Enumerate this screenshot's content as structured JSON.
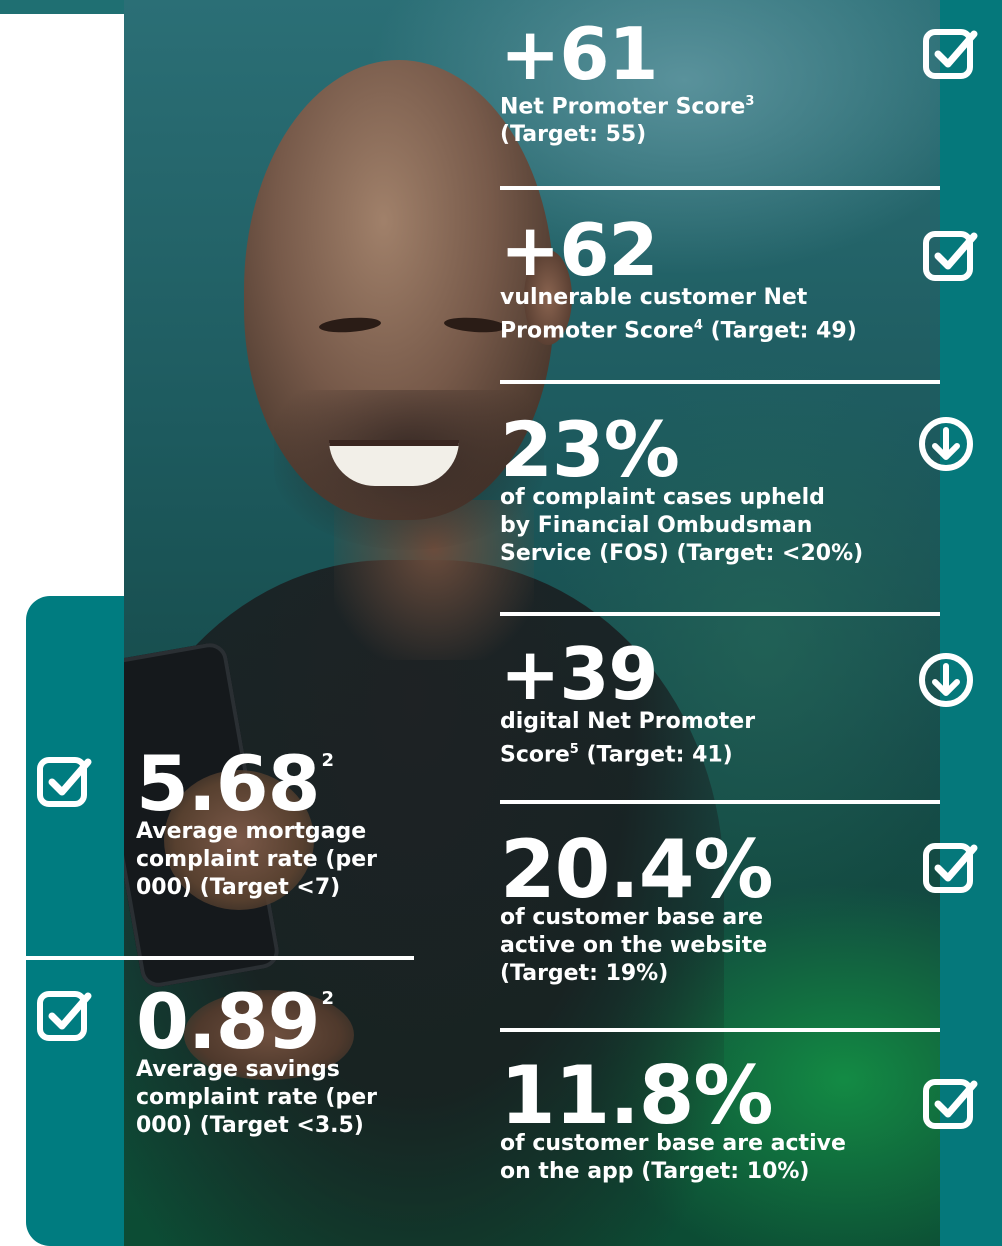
{
  "right_column": [
    {
      "value": "+61",
      "desc_lines": [
        "Net Promoter Score",
        "(Target: 55)"
      ],
      "sup": "3",
      "icon": "check-square-icon"
    },
    {
      "value": "+62",
      "desc_lines": [
        "vulnerable customer Net",
        "Promoter Score",
        "(Target: 49)"
      ],
      "sup": "4",
      "icon": "check-square-icon"
    },
    {
      "value": "23%",
      "desc_lines": [
        "of complaint cases upheld",
        "by Financial Ombudsman",
        "Service (FOS) (Target: <20%)"
      ],
      "icon": "arrow-down-circle-icon"
    },
    {
      "value": "+39",
      "desc_lines": [
        "digital Net Promoter",
        "Score",
        "(Target: 41)"
      ],
      "sup": "5",
      "icon": "arrow-down-circle-icon"
    },
    {
      "value": "20.4%",
      "desc_lines": [
        "of customer base are",
        "active on the website",
        "(Target: 19%)"
      ],
      "icon": "check-square-icon"
    },
    {
      "value": "11.8%",
      "desc_lines": [
        "of customer base are active",
        "on the app (Target: 10%)"
      ],
      "icon": "check-square-icon"
    }
  ],
  "left_column": [
    {
      "value": "5.68",
      "sup": "2",
      "desc_lines": [
        "Average mortgage",
        "complaint rate (per",
        "000) (Target <7)"
      ],
      "icon": "check-square-icon"
    },
    {
      "value": "0.89",
      "sup": "2",
      "desc_lines": [
        "Average savings",
        "complaint rate (per",
        "000) (Target <3.5)"
      ],
      "icon": "check-square-icon"
    }
  ],
  "colors": {
    "teal_panel": "#007c80",
    "text": "#ffffff"
  }
}
